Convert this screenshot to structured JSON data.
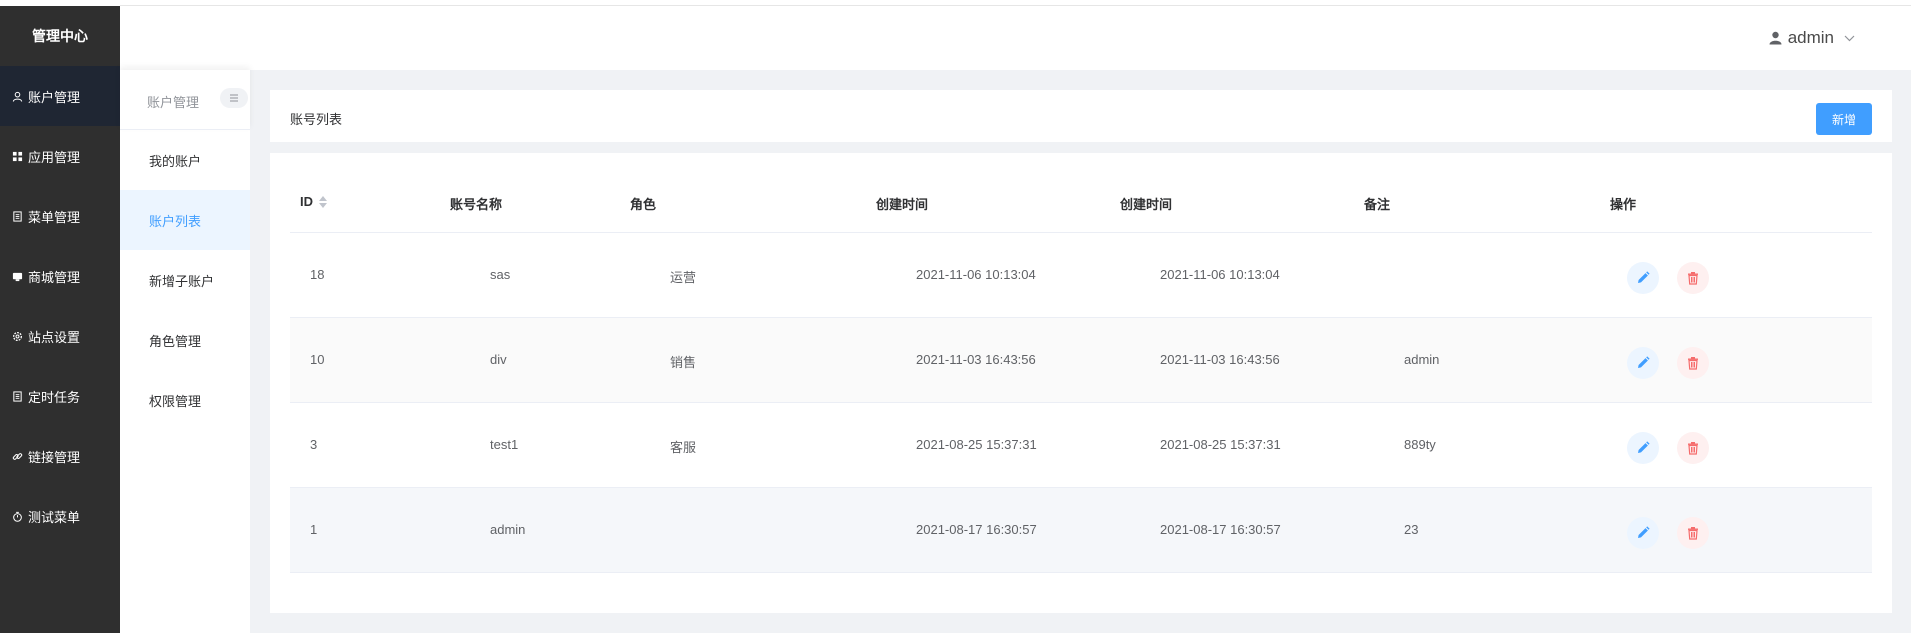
{
  "app": {
    "title": "管理中心"
  },
  "sidebar": {
    "items": [
      {
        "label": "账户管理",
        "icon": "user-icon",
        "active": true
      },
      {
        "label": "应用管理",
        "icon": "grid-icon"
      },
      {
        "label": "菜单管理",
        "icon": "document-icon"
      },
      {
        "label": "商城管理",
        "icon": "shop-icon"
      },
      {
        "label": "站点设置",
        "icon": "gear-icon"
      },
      {
        "label": "定时任务",
        "icon": "document-icon"
      },
      {
        "label": "链接管理",
        "icon": "link-icon"
      },
      {
        "label": "测试菜单",
        "icon": "timer-icon"
      }
    ]
  },
  "header": {
    "user": "admin"
  },
  "subsidebar": {
    "title": "账户管理",
    "items": [
      {
        "label": "我的账户"
      },
      {
        "label": "账户列表",
        "active": true
      },
      {
        "label": "新增子账户"
      },
      {
        "label": "角色管理"
      },
      {
        "label": "权限管理"
      }
    ]
  },
  "page": {
    "title": "账号列表",
    "add_label": "新增"
  },
  "table": {
    "columns": [
      "ID",
      "账号名称",
      "角色",
      "创建时间",
      "创建时间",
      "备注",
      "操作"
    ],
    "rows": [
      {
        "id": "18",
        "name": "sas",
        "role": "运营",
        "created": "2021-11-06 10:13:04",
        "updated": "2021-11-06 10:13:04",
        "note": ""
      },
      {
        "id": "10",
        "name": "div",
        "role": "销售",
        "created": "2021-11-03 16:43:56",
        "updated": "2021-11-03 16:43:56",
        "note": "admin"
      },
      {
        "id": "3",
        "name": "test1",
        "role": "客服",
        "created": "2021-08-25 15:37:31",
        "updated": "2021-08-25 15:37:31",
        "note": "889ty"
      },
      {
        "id": "1",
        "name": "admin",
        "role": "",
        "created": "2021-08-17 16:30:57",
        "updated": "2021-08-17 16:30:57",
        "note": "23"
      }
    ]
  },
  "colors": {
    "primary": "#409eff",
    "danger": "#f56c6c",
    "sidebar_bg": "#2f2f2f"
  }
}
